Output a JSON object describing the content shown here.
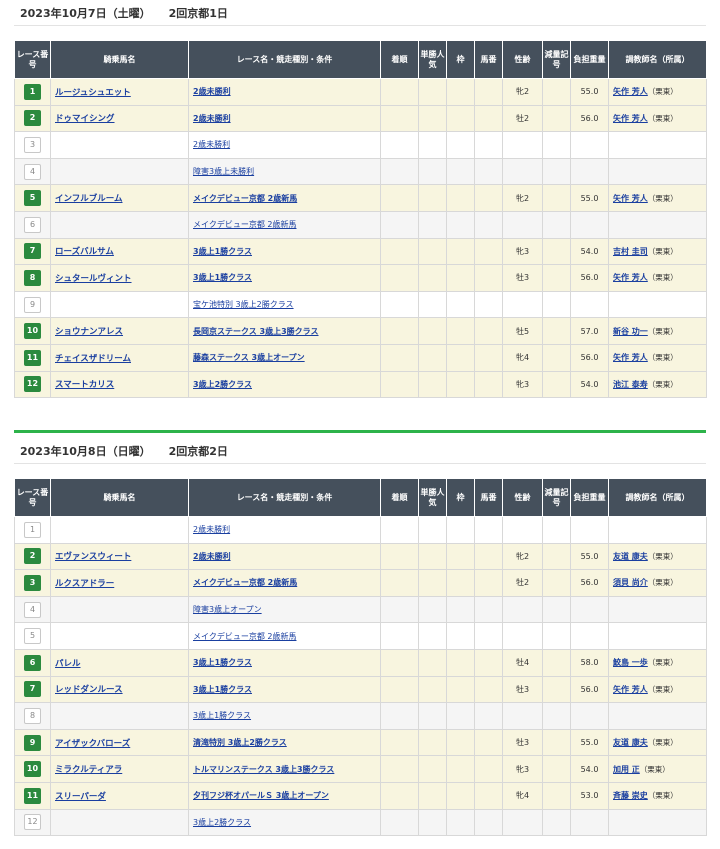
{
  "headers": {
    "race_no": "レース番号",
    "horse": "騎乗馬名",
    "race": "レース名・競走種別・条件",
    "finish": "着順",
    "popularity": "単勝人気",
    "frame": "枠",
    "horse_no": "馬番",
    "sex_age": "性齢",
    "weight_mark": "減量記号",
    "carried": "負担重量",
    "trainer": "調教師名（所属）"
  },
  "days": [
    {
      "date": "2023年10月7日（土曜）",
      "venue": "2回京都1日",
      "rows": [
        {
          "no": "1",
          "ride": true,
          "horse": "ルージュシュエット",
          "race": "2歳未勝利",
          "sex": "牝2",
          "weight": "55.0",
          "trainer": "矢作 芳人",
          "aff": "（栗東）"
        },
        {
          "no": "2",
          "ride": true,
          "horse": "ドゥマイシング",
          "race": "2歳未勝利",
          "sex": "牡2",
          "weight": "56.0",
          "trainer": "矢作 芳人",
          "aff": "（栗東）"
        },
        {
          "no": "3",
          "ride": false,
          "horse": "",
          "race": "2歳未勝利",
          "sex": "",
          "weight": "",
          "trainer": "",
          "aff": ""
        },
        {
          "no": "4",
          "ride": false,
          "horse": "",
          "race": "障害3歳上未勝利",
          "sex": "",
          "weight": "",
          "trainer": "",
          "aff": ""
        },
        {
          "no": "5",
          "ride": true,
          "horse": "インフルブルーム",
          "race": "メイクデビュー京都 2歳新馬",
          "sex": "牝2",
          "weight": "55.0",
          "trainer": "矢作 芳人",
          "aff": "（栗東）"
        },
        {
          "no": "6",
          "ride": false,
          "horse": "",
          "race": "メイクデビュー京都 2歳新馬",
          "sex": "",
          "weight": "",
          "trainer": "",
          "aff": ""
        },
        {
          "no": "7",
          "ride": true,
          "horse": "ローズバルサム",
          "race": "3歳上1勝クラス",
          "sex": "牝3",
          "weight": "54.0",
          "trainer": "吉村 圭司",
          "aff": "（栗東）"
        },
        {
          "no": "8",
          "ride": true,
          "horse": "シュタールヴィント",
          "race": "3歳上1勝クラス",
          "sex": "牡3",
          "weight": "56.0",
          "trainer": "矢作 芳人",
          "aff": "（栗東）"
        },
        {
          "no": "9",
          "ride": false,
          "horse": "",
          "race": "宝ケ池特別 3歳上2勝クラス",
          "sex": "",
          "weight": "",
          "trainer": "",
          "aff": ""
        },
        {
          "no": "10",
          "ride": true,
          "horse": "ショウナンアレス",
          "race": "長岡京ステークス 3歳上3勝クラス",
          "sex": "牡5",
          "weight": "57.0",
          "trainer": "新谷 功一",
          "aff": "（栗東）"
        },
        {
          "no": "11",
          "ride": true,
          "horse": "チェイスザドリーム",
          "race": "藤森ステークス 3歳上オープン",
          "sex": "牝4",
          "weight": "56.0",
          "trainer": "矢作 芳人",
          "aff": "（栗東）"
        },
        {
          "no": "12",
          "ride": true,
          "horse": "スマートカリス",
          "race": "3歳上2勝クラス",
          "sex": "牝3",
          "weight": "54.0",
          "trainer": "池江 泰寿",
          "aff": "（栗東）"
        }
      ]
    },
    {
      "date": "2023年10月8日（日曜）",
      "venue": "2回京都2日",
      "rows": [
        {
          "no": "1",
          "ride": false,
          "horse": "",
          "race": "2歳未勝利",
          "sex": "",
          "weight": "",
          "trainer": "",
          "aff": ""
        },
        {
          "no": "2",
          "ride": true,
          "horse": "エヴァンスウィート",
          "race": "2歳未勝利",
          "sex": "牝2",
          "weight": "55.0",
          "trainer": "友道 康夫",
          "aff": "（栗東）"
        },
        {
          "no": "3",
          "ride": true,
          "horse": "ルクスアドラー",
          "race": "メイクデビュー京都 2歳新馬",
          "sex": "牡2",
          "weight": "56.0",
          "trainer": "須貝 尚介",
          "aff": "（栗東）"
        },
        {
          "no": "4",
          "ride": false,
          "horse": "",
          "race": "障害3歳上オープン",
          "sex": "",
          "weight": "",
          "trainer": "",
          "aff": ""
        },
        {
          "no": "5",
          "ride": false,
          "horse": "",
          "race": "メイクデビュー京都 2歳新馬",
          "sex": "",
          "weight": "",
          "trainer": "",
          "aff": ""
        },
        {
          "no": "6",
          "ride": true,
          "horse": "パレル",
          "race": "3歳上1勝クラス",
          "sex": "牡4",
          "weight": "58.0",
          "trainer": "鮫島 一歩",
          "aff": "（栗東）"
        },
        {
          "no": "7",
          "ride": true,
          "horse": "レッドダンルース",
          "race": "3歳上1勝クラス",
          "sex": "牡3",
          "weight": "56.0",
          "trainer": "矢作 芳人",
          "aff": "（栗東）"
        },
        {
          "no": "8",
          "ride": false,
          "horse": "",
          "race": "3歳上1勝クラス",
          "sex": "",
          "weight": "",
          "trainer": "",
          "aff": ""
        },
        {
          "no": "9",
          "ride": true,
          "horse": "アイザックバローズ",
          "race": "清滝特別 3歳上2勝クラス",
          "sex": "牡3",
          "weight": "55.0",
          "trainer": "友道 康夫",
          "aff": "（栗東）"
        },
        {
          "no": "10",
          "ride": true,
          "horse": "ミラクルティアラ",
          "race": "トルマリンステークス 3歳上3勝クラス",
          "sex": "牝3",
          "weight": "54.0",
          "trainer": "加用 正",
          "aff": "（栗東）"
        },
        {
          "no": "11",
          "ride": true,
          "horse": "スリーパーダ",
          "race": "夕刊フジ杯オパールＳ 3歳上オープン",
          "sex": "牝4",
          "weight": "53.0",
          "trainer": "斉藤 崇史",
          "aff": "（栗東）"
        },
        {
          "no": "12",
          "ride": false,
          "horse": "",
          "race": "3歳上2勝クラス",
          "sex": "",
          "weight": "",
          "trainer": "",
          "aff": ""
        }
      ]
    }
  ]
}
